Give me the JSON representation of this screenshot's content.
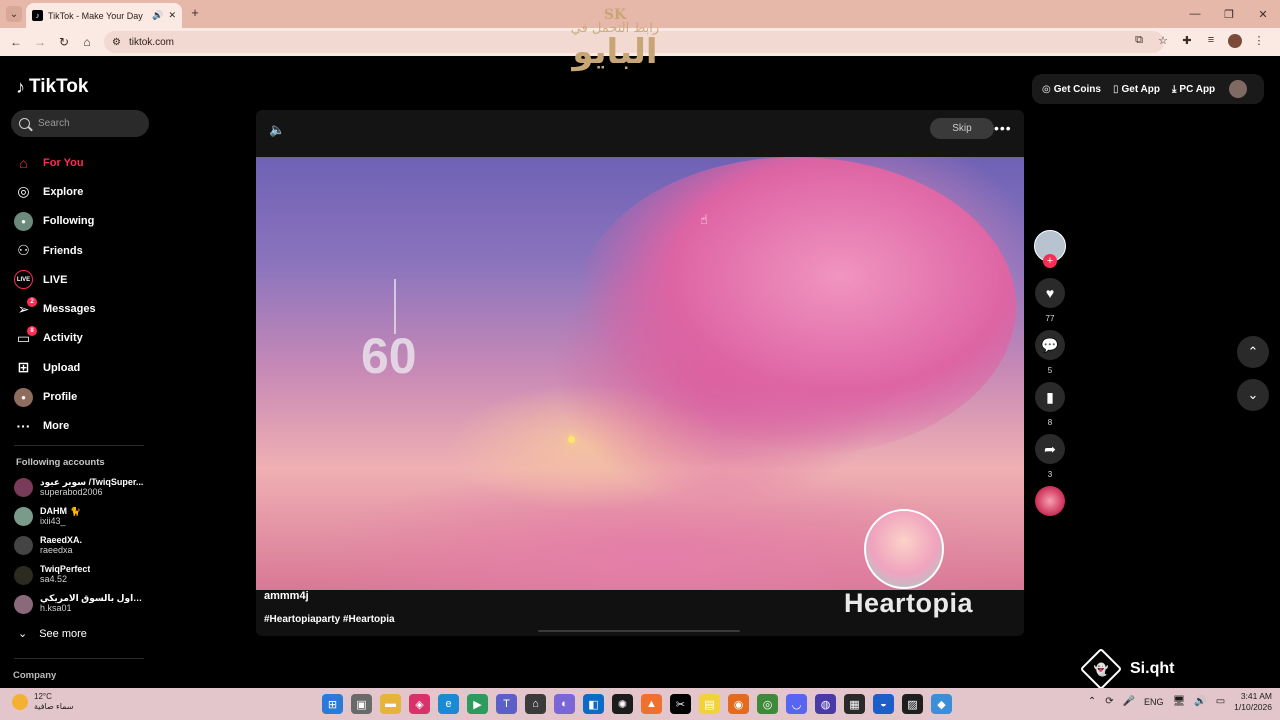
{
  "browser": {
    "tab_title": "TikTok - Make Your Day",
    "url": "tiktok.com"
  },
  "watermark": {
    "logo": "SK",
    "line1": "رابط التحمل في",
    "line2": "البايو"
  },
  "sidebar": {
    "brand": "TikTok",
    "search_placeholder": "Search",
    "nav": [
      {
        "label": "For You",
        "icon": "home-icon"
      },
      {
        "label": "Explore",
        "icon": "compass-icon"
      },
      {
        "label": "Following",
        "icon": "following-icon"
      },
      {
        "label": "Friends",
        "icon": "friends-icon"
      },
      {
        "label": "LIVE",
        "icon": "live-icon"
      },
      {
        "label": "Messages",
        "icon": "messages-icon",
        "badge": "2"
      },
      {
        "label": "Activity",
        "icon": "activity-icon",
        "badge": "8"
      },
      {
        "label": "Upload",
        "icon": "upload-icon"
      },
      {
        "label": "Profile",
        "icon": "profile-icon"
      },
      {
        "label": "More",
        "icon": "more-icon"
      }
    ],
    "following_title": "Following accounts",
    "accounts": [
      {
        "name": "سوبر عبود /TwiqSuper...",
        "handle": "superabod2006"
      },
      {
        "name": "DAHM 🐈",
        "handle": "ixii43_"
      },
      {
        "name": "RaeedXA.",
        "handle": "raeedxa"
      },
      {
        "name": "TwiqPerfect",
        "handle": "sa4.52"
      },
      {
        "name": "متداول بالسوق الامريكي",
        "handle": "h.ksa01"
      }
    ],
    "see_more": "See more",
    "company": "Company"
  },
  "player": {
    "skip": "Skip",
    "timer": "60",
    "game_title": "Heartopia",
    "author": "ammm4j",
    "hashtags": "#Heartopiaparty #Heartopia"
  },
  "actions": {
    "likes": "77",
    "comments": "5",
    "saves": "8",
    "shares": "3"
  },
  "top_right": {
    "get_coins": "Get Coins",
    "get_app": "Get App",
    "pc_app": "PC App"
  },
  "overlay_brand": "Si.qht",
  "taskbar": {
    "temp": "12°C",
    "weather": "سماء صافية",
    "lang": "ENG",
    "time": "3:41 AM",
    "date": "1/10/2026"
  }
}
